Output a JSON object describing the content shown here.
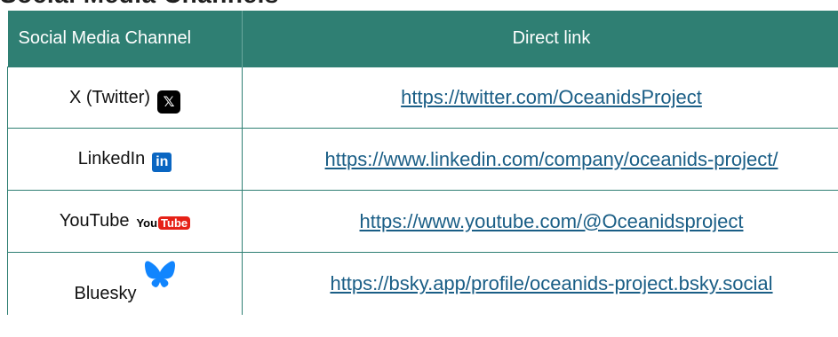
{
  "heading": "Social Media Channels",
  "table": {
    "headers": [
      "Social Media Channel",
      "Direct link"
    ],
    "rows": [
      {
        "channel": "X (Twitter)",
        "icon": "x-logo-icon",
        "link": "https://twitter.com/OceanidsProject"
      },
      {
        "channel": "LinkedIn",
        "icon": "linkedin-logo-icon",
        "link": "https://www.linkedin.com/company/oceanids-project/"
      },
      {
        "channel": "YouTube",
        "icon": "youtube-logo-icon",
        "link": "https://www.youtube.com/@Oceanidsproject"
      },
      {
        "channel": "Bluesky",
        "icon": "bluesky-butterfly-icon",
        "link": "https://bsky.app/profile/oceanids-project.bsky.social"
      }
    ]
  },
  "colors": {
    "header_bg": "#2f7f73",
    "link": "#1a5e86",
    "border": "#2f7f73"
  }
}
